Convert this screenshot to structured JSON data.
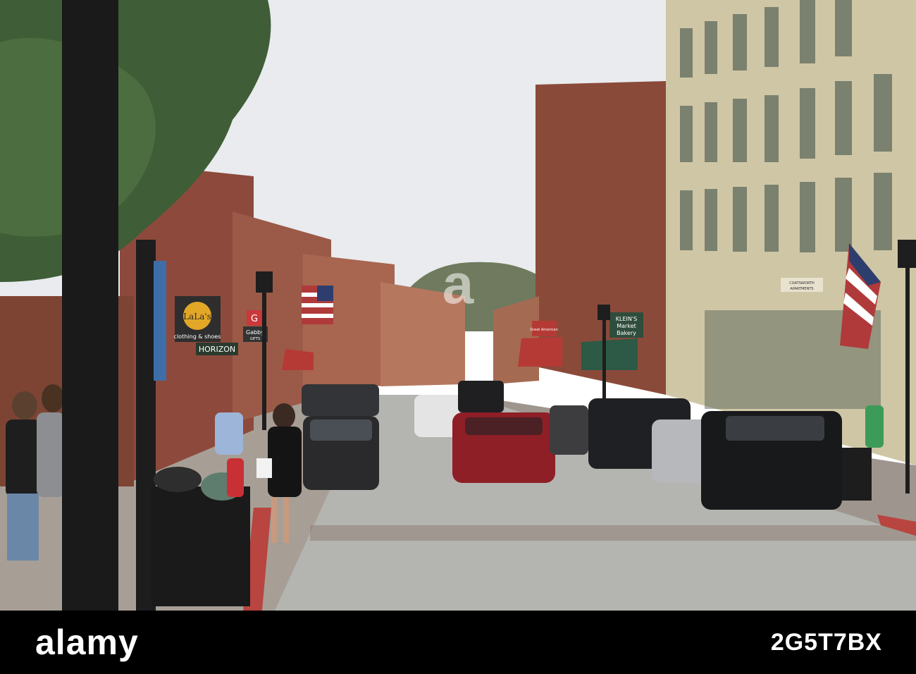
{
  "watermark": {
    "logo": "alamy",
    "image_id": "2G5T7BX"
  },
  "signs": {
    "lalas_name": "LaLa's",
    "lalas_sub": "clothing & shoes",
    "horizon": "HORIZON",
    "gabby_letter": "G",
    "gabby": "Gabby",
    "gabby_sub": "GIFTS",
    "kleins_1": "KLEIN'S",
    "kleins_2": "Market",
    "kleins_3": "Bakery",
    "coatsworth_1": "COATSWORTH",
    "coatsworth_2": "APARTMENTS",
    "great_american": "Great American"
  },
  "colors": {
    "sky": "#e9ebee",
    "brick": "#8d4a3c",
    "cream_building": "#cfc6a6",
    "road": "#b4b4b0",
    "sidewalk": "#a79f96",
    "black_bar": "#000000"
  }
}
